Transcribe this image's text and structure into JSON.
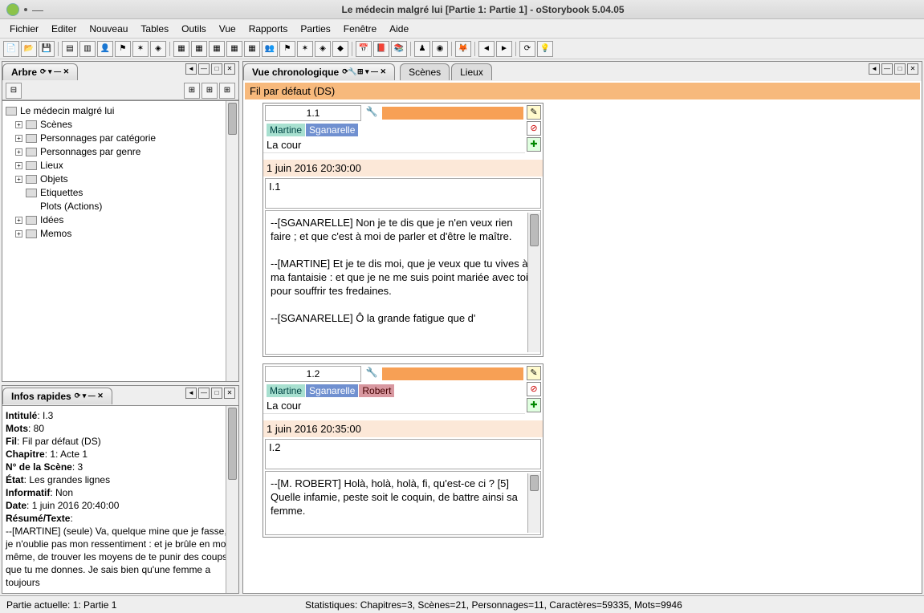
{
  "window": {
    "title": "Le médecin malgré lui [Partie 1: Partie 1] - oStorybook 5.04.05"
  },
  "menu": [
    "Fichier",
    "Editer",
    "Nouveau",
    "Tables",
    "Outils",
    "Vue",
    "Rapports",
    "Parties",
    "Fenêtre",
    "Aide"
  ],
  "panels": {
    "arbre": {
      "title": "Arbre",
      "root": "Le médecin malgré lui",
      "nodes": [
        "Scènes",
        "Personnages par catégorie",
        "Personnages par genre",
        "Lieux",
        "Objets",
        "Etiquettes",
        "Plots (Actions)",
        "Idées",
        "Memos"
      ]
    },
    "infos": {
      "title": "Infos rapides",
      "fields": {
        "intitule_l": "Intitulé",
        "intitule_v": "I.3",
        "mots_l": "Mots",
        "mots_v": "80",
        "fil_l": "Fil",
        "fil_v": "Fil par défaut (DS)",
        "chapitre_l": "Chapitre",
        "chapitre_v": "1: Acte 1",
        "numscene_l": "N° de la Scène",
        "numscene_v": "3",
        "etat_l": "État",
        "etat_v": "Les grandes lignes",
        "informatif_l": "Informatif",
        "informatif_v": "Non",
        "date_l": "Date",
        "date_v": "1 juin 2016 20:40:00",
        "resume_l": "Résumé/Texte",
        "resume_v": "--[MARTINE] (seule) Va, quelque mine que je fasse, je n'oublie pas mon ressentiment : et je brûle en moi-même, de trouver les moyens de te punir des coups que tu me donnes. Je sais bien qu'une femme a toujours"
      }
    },
    "chrono": {
      "title": "Vue chronologique",
      "tabs": [
        "Scènes",
        "Lieux"
      ],
      "strand": "Fil par défaut (DS)",
      "scenes": [
        {
          "num": "1.1",
          "chars": [
            "Martine",
            "Sganarelle"
          ],
          "loc": "La cour",
          "dt": "1 juin 2016 20:30:00",
          "id": "I.1",
          "text": "--[SGANARELLE] Non je te dis que je n'en veux rien faire ; et que c'est à moi de parler et d'être le maître.\n\n--[MARTINE] Et je te dis moi, que je veux que tu vives à ma fantaisie : et que je ne me suis point mariée avec toi, pour souffrir tes fredaines.\n\n--[SGANARELLE] Ô la grande fatigue que d'"
        },
        {
          "num": "1.2",
          "chars": [
            "Martine",
            "Sganarelle",
            "Robert"
          ],
          "loc": "La cour",
          "dt": "1 juin 2016 20:35:00",
          "id": "I.2",
          "text": "--[M. ROBERT] Holà, holà, holà, fi, qu'est-ce ci ? [5] Quelle infamie, peste soit le coquin, de battre ainsi sa femme."
        }
      ]
    }
  },
  "status": {
    "part": "Partie actuelle: 1: Partie 1",
    "stats": "Statistiques: Chapitres=3,  Scènes=21,  Personnages=11,  Caractères=59335,  Mots=9946"
  }
}
